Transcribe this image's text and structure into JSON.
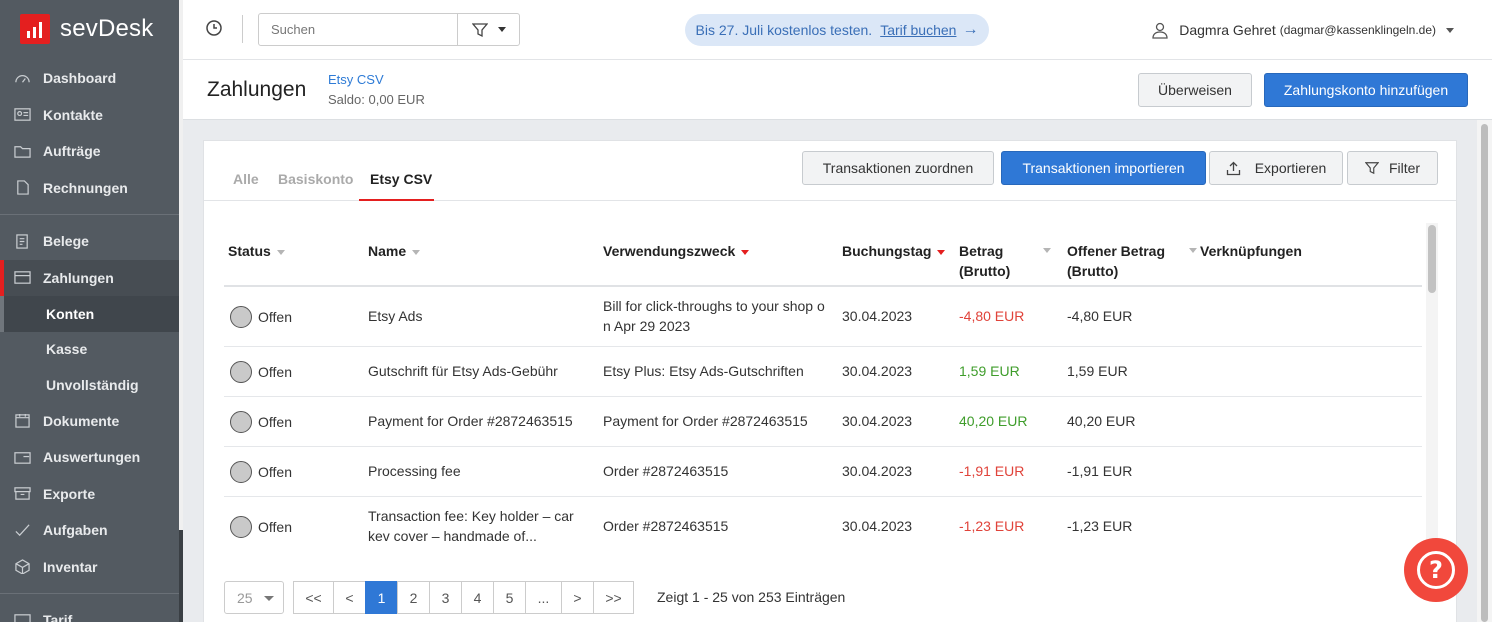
{
  "sidebar": {
    "logo_text": "sevDesk",
    "items": [
      {
        "label": "Dashboard",
        "icon": "speedometer-icon"
      },
      {
        "label": "Kontakte",
        "icon": "contact-card-icon"
      },
      {
        "label": "Aufträge",
        "icon": "folder-icon"
      },
      {
        "label": "Rechnungen",
        "icon": "document-icon"
      },
      {
        "label": "Belege",
        "icon": "receipt-icon"
      },
      {
        "label": "Zahlungen",
        "icon": "credit-card-icon"
      },
      {
        "label": "Dokumente",
        "icon": "calendar-doc-icon"
      },
      {
        "label": "Auswertungen",
        "icon": "analytics-icon"
      },
      {
        "label": "Exporte",
        "icon": "archive-icon"
      },
      {
        "label": "Aufgaben",
        "icon": "check-icon"
      },
      {
        "label": "Inventar",
        "icon": "box-icon"
      },
      {
        "label": "Tarif",
        "icon": "tag-icon"
      }
    ],
    "sub_items": [
      {
        "label": "Konten"
      },
      {
        "label": "Kasse"
      },
      {
        "label": "Unvollständig"
      }
    ]
  },
  "topbar": {
    "search_placeholder": "Suchen",
    "trial_text": "Bis 27. Juli kostenlos testen.",
    "trial_link": "Tarif buchen",
    "user_name": "Dagmra Gehret",
    "user_email": "(dagmar@kassenklingeln.de)"
  },
  "header": {
    "title": "Zahlungen",
    "account_name": "Etsy CSV",
    "saldo": "Saldo: 0,00 EUR",
    "transfer_label": "Überweisen",
    "add_account_label": "Zahlungskonto hinzufügen"
  },
  "tabs": [
    {
      "label": "Alle"
    },
    {
      "label": "Basiskonto"
    },
    {
      "label": "Etsy CSV"
    }
  ],
  "toolbar": {
    "assign_label": "Transaktionen zuordnen",
    "import_label": "Transaktionen importieren",
    "export_label": "Exportieren",
    "filter_label": "Filter"
  },
  "table": {
    "columns": {
      "status": "Status",
      "name": "Name",
      "purpose": "Verwendungszweck",
      "date": "Buchungstag",
      "amount_1": "Betrag",
      "amount_2": "(Brutto)",
      "open_1": "Offener Betrag",
      "open_2": "(Brutto)",
      "links": "Verknüpfungen"
    },
    "rows": [
      {
        "status": "Offen",
        "name": "Etsy Ads",
        "purpose": "Bill for click-throughs to your shop o n Apr 29 2023",
        "date": "30.04.2023",
        "amount": "-4,80 EUR",
        "open": "-4,80 EUR"
      },
      {
        "status": "Offen",
        "name": "Gutschrift für Etsy Ads-Gebühr",
        "purpose": "Etsy Plus: Etsy Ads-Gutschriften",
        "date": "30.04.2023",
        "amount": "1,59 EUR",
        "open": "1,59 EUR"
      },
      {
        "status": "Offen",
        "name": "Payment for Order #2872463515",
        "purpose": "Payment for Order #2872463515",
        "date": "30.04.2023",
        "amount": "40,20 EUR",
        "open": "40,20 EUR"
      },
      {
        "status": "Offen",
        "name": "Processing fee",
        "purpose": "Order #2872463515",
        "date": "30.04.2023",
        "amount": "-1,91 EUR",
        "open": "-1,91 EUR"
      },
      {
        "status": "Offen",
        "name": "Transaction fee: Key holder – car kev cover – handmade of...",
        "purpose": "Order #2872463515",
        "date": "30.04.2023",
        "amount": "-1,23 EUR",
        "open": "-1,23 EUR"
      }
    ]
  },
  "pagination": {
    "page_size": "25",
    "buttons": [
      "<<",
      "<",
      "1",
      "2",
      "3",
      "4",
      "5",
      "...",
      ">",
      ">>"
    ],
    "active_page": "1",
    "info": "Zeigt 1 - 25 von 253 Einträgen"
  },
  "help": {
    "label": "?"
  },
  "colors": {
    "accent": "#2f78d6",
    "brand_red": "#e41f1f",
    "negative": "#e0433a",
    "positive": "#3f9d2b"
  }
}
